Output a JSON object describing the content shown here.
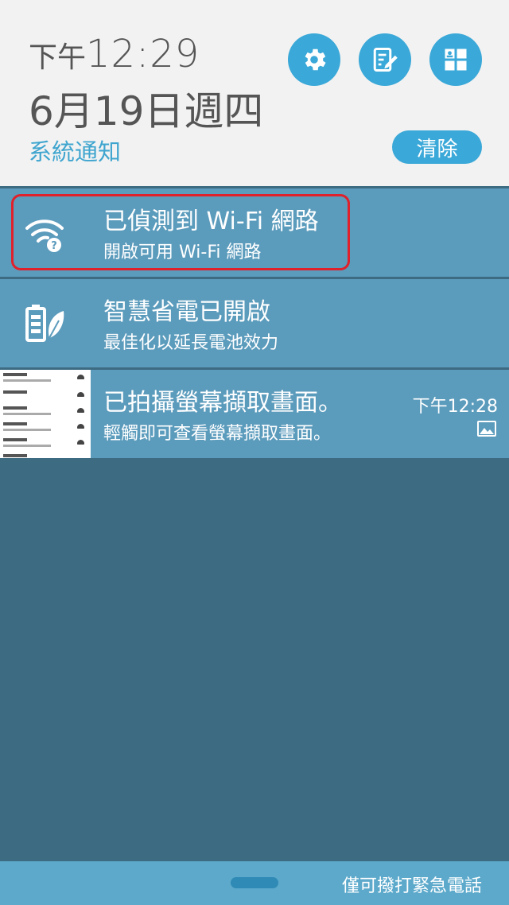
{
  "header": {
    "time_prefix": "下午",
    "time_clock": "12:29",
    "date": "6月19日週四",
    "section_label": "系統通知",
    "clear_label": "清除",
    "buttons": [
      "gear-icon",
      "edit-icon",
      "apps-icon"
    ]
  },
  "notifications": [
    {
      "icon": "wifi-question-icon",
      "title": "已偵測到 Wi-Fi 網路",
      "subtitle": "開啟可用 Wi-Fi 網路"
    },
    {
      "icon": "battery-leaf-icon",
      "title": "智慧省電已開啟",
      "subtitle": "最佳化以延長電池效力"
    },
    {
      "icon": "image-icon",
      "title": "已拍攝螢幕擷取畫面。",
      "subtitle": "輕觸即可查看螢幕擷取畫面。",
      "time": "下午12:28"
    }
  ],
  "footer": {
    "emergency_label": "僅可撥打緊急電話"
  },
  "colors": {
    "accent": "#3aa8d8",
    "notification_bg": "#5b9bbc",
    "background": "#3d6b82",
    "highlight": "#e0202a"
  }
}
